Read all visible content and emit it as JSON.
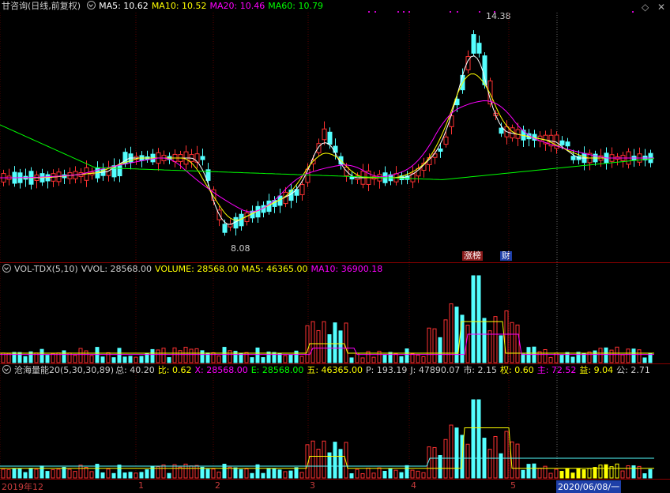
{
  "main": {
    "title": "甘咨询(日线,前复权)",
    "ma5": "MA5: 10.62",
    "ma10": "MA10: 10.52",
    "ma20": "MA20: 10.46",
    "ma60": "MA60: 10.79",
    "high_label": "14.38",
    "low_label": "8.08",
    "tag_zhangbang": "涨榜",
    "tag_cai": "财"
  },
  "vol": {
    "title": "VOL-TDX(5,10)",
    "vvol": "VVOL: 28568.00",
    "volume": "VOLUME: 28568.00",
    "ma5": "MA5: 46365.00",
    "ma10": "MA10: 36900.18"
  },
  "cang": {
    "title": "沧海量能20(5,30,30,89)",
    "zong": "总: 40.20",
    "bi": "比: 0.62",
    "x": "X: 28568.00",
    "e": "E: 28568.00",
    "wu": "五: 46365.00",
    "p": "P: 193.19",
    "j": "J: 47890.07",
    "shi": "市: 2.15",
    "quan": "权: 0.60",
    "zhu": "主: 72.52",
    "yi": "益: 9.04",
    "gong": "公: 2.71"
  },
  "axis": {
    "t0": "2019年12",
    "t1": "1",
    "t2": "2",
    "t3": "3",
    "t4": "4",
    "t5": "5",
    "date": "2020/06/08/一"
  },
  "colors": {
    "up": "#ff3232",
    "down": "#54ffff",
    "ma5": "#ffffff",
    "ma10": "#ffff00",
    "ma20": "#ff00ff",
    "ma60": "#00ff00"
  }
}
